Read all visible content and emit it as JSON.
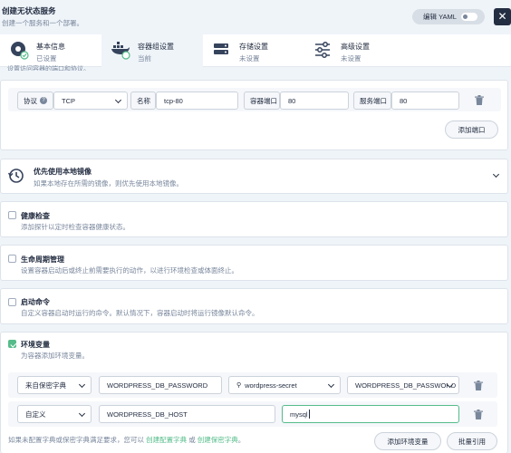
{
  "header": {
    "title": "创建无状态服务",
    "subtitle": "创建一个服务和一个部署。",
    "edit_yaml_label": "编辑 YAML",
    "close_label": "✕"
  },
  "steps": [
    {
      "label": "基本信息",
      "status": "已设置"
    },
    {
      "label": "容器组设置",
      "status": "当前"
    },
    {
      "label": "存储设置",
      "status": "未设置"
    },
    {
      "label": "高级设置",
      "status": "未设置"
    }
  ],
  "cut_text": "设置访问容器的端口和协议。",
  "ports": {
    "protocol_label": "协议",
    "protocol_value": "TCP",
    "name_label": "名称",
    "name_value": "tcp-80",
    "container_port_label": "容器端口",
    "container_port_value": "80",
    "service_port_label": "服务端口",
    "service_port_value": "80",
    "add_port_label": "添加端口"
  },
  "local_image": {
    "title": "优先使用本地镜像",
    "desc": "如果本地存在所需的镜像，则优先使用本地镜像。"
  },
  "health_check": {
    "title": "健康检查",
    "desc": "添加探针以定时检查容器健康状态。"
  },
  "lifecycle": {
    "title": "生命周期管理",
    "desc": "设置容器启动后或终止前需要执行的动作，以进行环境检查或体面终止。"
  },
  "start_command": {
    "title": "启动命令",
    "desc": "自定义容器启动时运行的命令。默认情况下，容器启动时将运行镜像默认命令。"
  },
  "env": {
    "title": "环境变量",
    "desc": "为容器添加环境变量。",
    "rows": [
      {
        "type": "来自保密字典",
        "key": "WORDPRESS_DB_PASSWORD",
        "resource": "wordpress-secret",
        "resource_key": "WORDPRESS_DB_PASSWORD"
      },
      {
        "type": "自定义",
        "key": "WORDPRESS_DB_HOST",
        "value": "mysql"
      }
    ],
    "footer_text": "如果未配置字典或保密字典满足要求，您可以",
    "link_configmap": "创建配置字典",
    "footer_or": "或",
    "link_secret": "创建保密字典",
    "footer_end": "。",
    "add_env_label": "添加环境变量",
    "batch_ref_label": "批量引用"
  }
}
